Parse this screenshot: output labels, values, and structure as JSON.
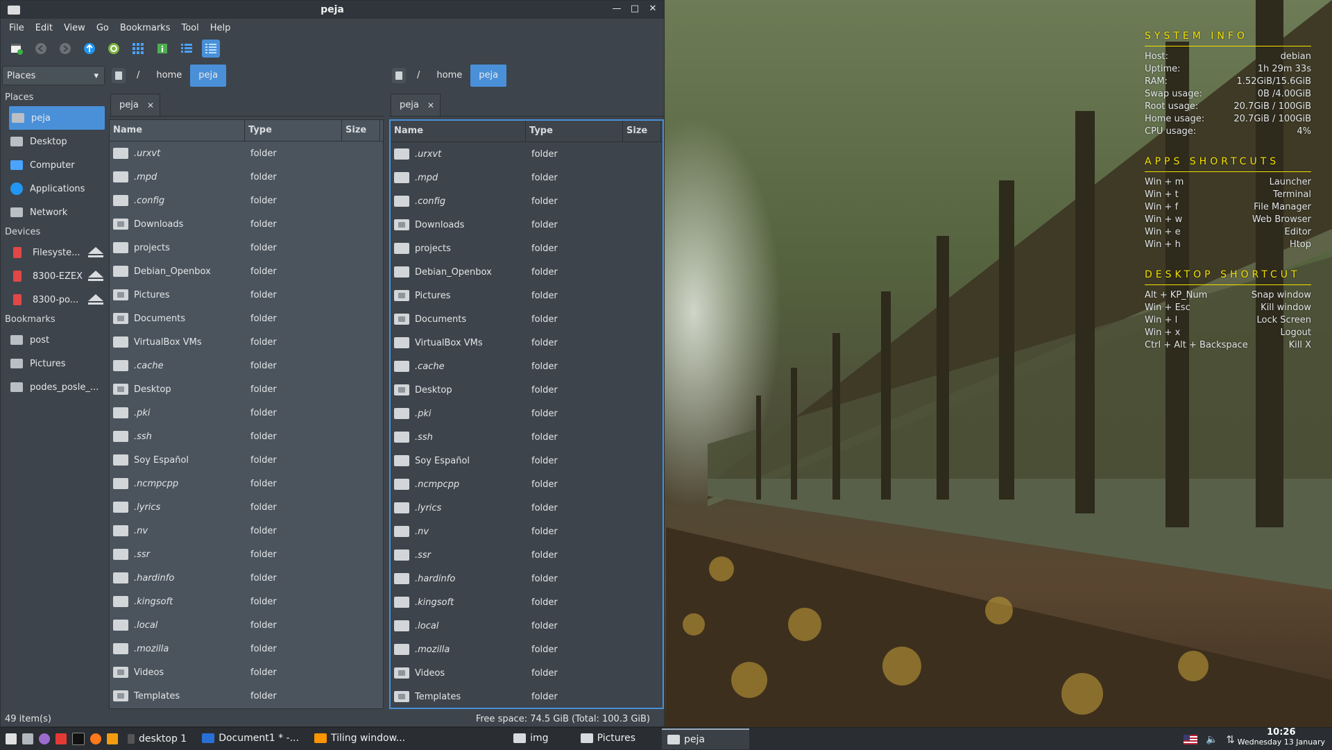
{
  "window": {
    "title": "peja",
    "menu": [
      "File",
      "Edit",
      "View",
      "Go",
      "Bookmarks",
      "Tool",
      "Help"
    ]
  },
  "sidebar": {
    "dropdown": "Places",
    "places_header": "Places",
    "places": [
      {
        "label": "peja",
        "icon": "home-folder-icon",
        "selected": true
      },
      {
        "label": "Desktop",
        "icon": "desktop-icon"
      },
      {
        "label": "Computer",
        "icon": "computer-icon"
      },
      {
        "label": "Applications",
        "icon": "applications-icon"
      },
      {
        "label": "Network",
        "icon": "network-icon"
      }
    ],
    "devices_header": "Devices",
    "devices": [
      {
        "label": "Filesyste..."
      },
      {
        "label": "8300-EZEX"
      },
      {
        "label": "8300-po..."
      }
    ],
    "bookmarks_header": "Bookmarks",
    "bookmarks": [
      {
        "label": "post"
      },
      {
        "label": "Pictures"
      },
      {
        "label": "podes_posle_..."
      }
    ]
  },
  "panes": {
    "left": {
      "crumbs": [
        "/",
        "home",
        "peja"
      ],
      "tab": "peja"
    },
    "right": {
      "crumbs": [
        "/",
        "home",
        "peja"
      ],
      "tab": "peja"
    },
    "columns": {
      "name": "Name",
      "type": "Type",
      "size": "Size"
    }
  },
  "files": [
    {
      "name": ".urxvt",
      "type": "folder",
      "hidden": true
    },
    {
      "name": ".mpd",
      "type": "folder",
      "hidden": true
    },
    {
      "name": ".config",
      "type": "folder",
      "hidden": true
    },
    {
      "name": "Downloads",
      "type": "folder",
      "special": true
    },
    {
      "name": "projects",
      "type": "folder"
    },
    {
      "name": "Debian_Openbox",
      "type": "folder"
    },
    {
      "name": "Pictures",
      "type": "folder",
      "special": true
    },
    {
      "name": "Documents",
      "type": "folder",
      "special": true
    },
    {
      "name": "VirtualBox VMs",
      "type": "folder"
    },
    {
      "name": ".cache",
      "type": "folder",
      "hidden": true
    },
    {
      "name": "Desktop",
      "type": "folder",
      "special": true
    },
    {
      "name": ".pki",
      "type": "folder",
      "hidden": true
    },
    {
      "name": ".ssh",
      "type": "folder",
      "hidden": true
    },
    {
      "name": "Soy Español",
      "type": "folder"
    },
    {
      "name": ".ncmpcpp",
      "type": "folder",
      "hidden": true
    },
    {
      "name": ".lyrics",
      "type": "folder",
      "hidden": true
    },
    {
      "name": ".nv",
      "type": "folder",
      "hidden": true
    },
    {
      "name": ".ssr",
      "type": "folder",
      "hidden": true
    },
    {
      "name": ".hardinfo",
      "type": "folder",
      "hidden": true
    },
    {
      "name": ".kingsoft",
      "type": "folder",
      "hidden": true
    },
    {
      "name": ".local",
      "type": "folder",
      "hidden": true
    },
    {
      "name": ".mozilla",
      "type": "folder",
      "hidden": true
    },
    {
      "name": "Videos",
      "type": "folder",
      "special": true
    },
    {
      "name": "Templates",
      "type": "folder",
      "special": true
    }
  ],
  "status": {
    "items": "49 item(s)",
    "free_space": "Free space: 74.5 GiB (Total: 100.3 GiB)"
  },
  "conky": {
    "system_header": "SYSTEM INFO",
    "system": [
      [
        "Host:",
        "debian"
      ],
      [
        "Uptime:",
        "1h 29m 33s"
      ],
      [
        "RAM:",
        "1.52GiB/15.6GiB"
      ],
      [
        "Swap usage:",
        "0B  /4.00GiB"
      ],
      [
        "Root usage:",
        "20.7GiB / 100GiB"
      ],
      [
        "Home usage:",
        "20.7GiB / 100GiB"
      ],
      [
        "CPU usage:",
        "4%"
      ]
    ],
    "apps_header": "APPS SHORTCUTS",
    "apps": [
      [
        "Win + m",
        "Launcher"
      ],
      [
        "Win + t",
        "Terminal"
      ],
      [
        "Win + f",
        "File Manager"
      ],
      [
        "Win + w",
        "Web Browser"
      ],
      [
        "Win + e",
        "Editor"
      ],
      [
        "Win + h",
        "Htop"
      ]
    ],
    "desktop_header": "DESKTOP SHORTCUT",
    "desktop": [
      [
        "Alt + KP_Num",
        "Snap window"
      ],
      [
        "Win + Esc",
        "Kill window"
      ],
      [
        "Win + l",
        "Lock Screen"
      ],
      [
        "Win + x",
        "Logout"
      ],
      [
        "Ctrl + Alt + Backspace",
        "Kill X"
      ]
    ],
    "color": "#f4e000"
  },
  "taskbar": {
    "desktop": "desktop 1",
    "tasks": [
      {
        "label": "Document1 * -...",
        "icon": "writer-icon"
      },
      {
        "label": "Tiling window...",
        "icon": "firefox-icon"
      },
      {
        "label": "img",
        "icon": "folder-icon"
      },
      {
        "label": "Pictures",
        "icon": "folder-icon"
      },
      {
        "label": "peja",
        "icon": "folder-icon",
        "active": true
      }
    ],
    "time": "10:26",
    "date": "Wednesday 13 January"
  },
  "colors": {
    "accent": "#4a90d9",
    "window_bg": "#3d444b"
  }
}
